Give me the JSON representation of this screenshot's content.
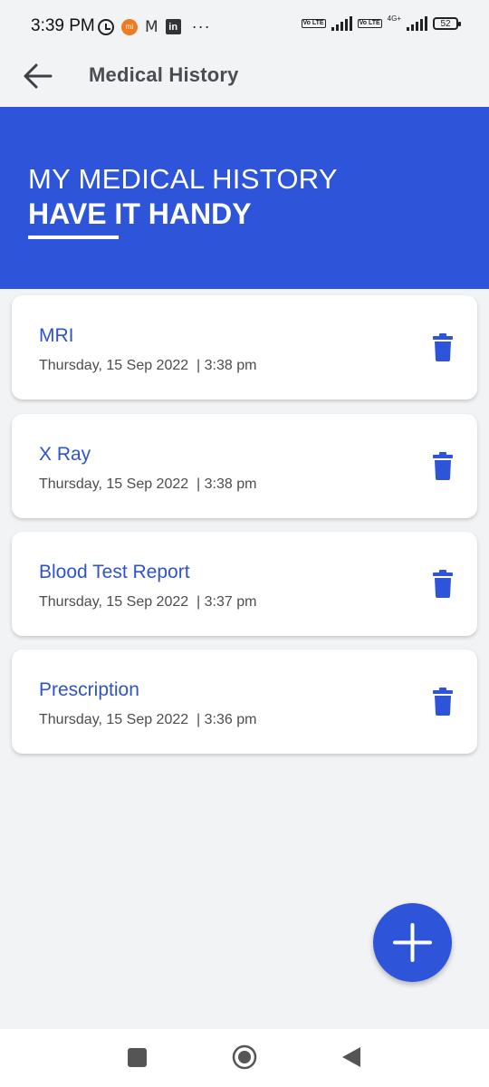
{
  "status_bar": {
    "time": "3:39 PM",
    "notification_icons": [
      "alarm-icon",
      "mi-icon",
      "gmail-icon",
      "linkedin-icon"
    ],
    "more": "···",
    "mi_label": "mi",
    "gmail_label": "M",
    "linkedin_label": "in",
    "volte_label": "Vo LTE",
    "network_label": "4G+",
    "battery": "52"
  },
  "app_bar": {
    "title": "Medical History"
  },
  "banner": {
    "line1": "MY MEDICAL HISTORY",
    "line2": "HAVE IT HANDY",
    "color": "#2e54da"
  },
  "records": [
    {
      "title": "MRI",
      "date": "Thursday, 15 Sep 2022",
      "time": "3:38 pm"
    },
    {
      "title": "X Ray",
      "date": "Thursday, 15 Sep 2022",
      "time": "3:38 pm"
    },
    {
      "title": "Blood Test Report",
      "date": "Thursday, 15 Sep 2022",
      "time": "3:37 pm"
    },
    {
      "title": "Prescription",
      "date": "Thursday, 15 Sep 2022",
      "time": "3:36 pm"
    }
  ],
  "fab": {
    "icon": "plus-icon",
    "color": "#2e54da"
  },
  "nav_bar": {
    "icons": [
      "recent-apps-icon",
      "home-icon",
      "back-icon"
    ]
  }
}
